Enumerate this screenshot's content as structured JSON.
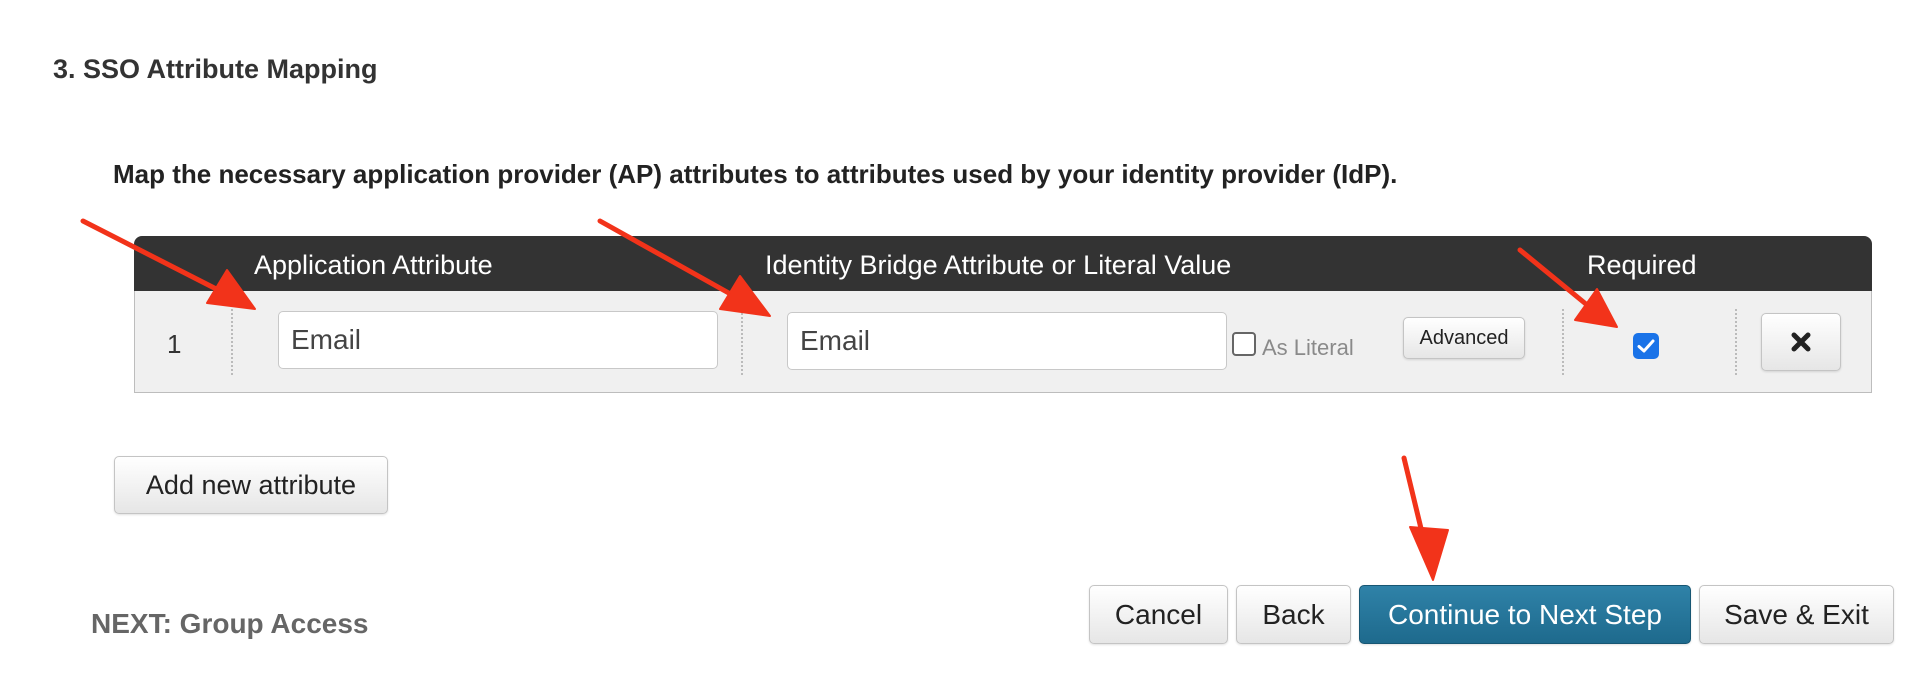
{
  "section": {
    "title": "3. SSO Attribute Mapping"
  },
  "instructions": "Map the necessary application provider (AP) attributes to attributes used by your identity provider (IdP).",
  "table": {
    "headers": {
      "app_attr": "Application Attribute",
      "idb_attr": "Identity Bridge Attribute or Literal Value",
      "required": "Required"
    },
    "rows": [
      {
        "index": "1",
        "application_attribute": "Email",
        "identity_attribute": "Email",
        "as_literal_label": "As Literal",
        "as_literal_checked": false,
        "advanced_label": "Advanced",
        "required_checked": true,
        "remove_icon": "close-icon"
      }
    ]
  },
  "add_attribute_label": "Add new attribute",
  "next_step": "NEXT: Group Access",
  "footer_buttons": {
    "cancel": "Cancel",
    "back": "Back",
    "continue": "Continue to Next Step",
    "save_exit": "Save & Exit"
  },
  "colors": {
    "header_bg": "#333333",
    "primary_button": "#1e6a8d",
    "checkbox_checked": "#1a73e8",
    "annotation_arrow": "#f2331a"
  }
}
